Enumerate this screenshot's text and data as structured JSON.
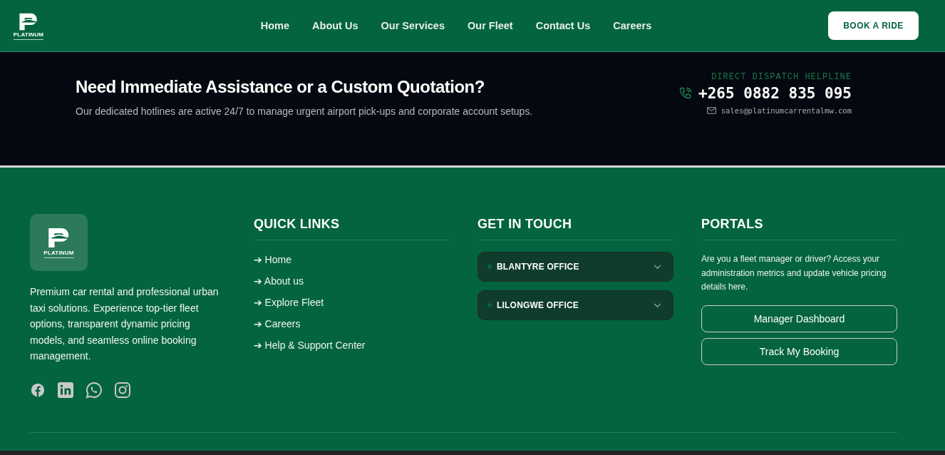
{
  "header": {
    "logo_text": "PLATINUM",
    "nav": [
      {
        "label": "Home",
        "selected": false
      },
      {
        "label": "About Us",
        "selected": false
      },
      {
        "label": "Our Services",
        "selected": false
      },
      {
        "label": "Our Fleet",
        "selected": false
      },
      {
        "label": "Contact Us",
        "selected": false
      },
      {
        "label": "Careers",
        "selected": false
      }
    ],
    "cta": "BOOK A RIDE"
  },
  "assistance": {
    "title": "Need Immediate Assistance or a Custom Quotation?",
    "text": "Our dedicated hotlines are active 24/7 to manage urgent airport pick-ups and corporate account setups.",
    "helpline_label": "DIRECT DISPATCH HELPLINE",
    "phone": "+265 0882 835 095",
    "email": "sales@platinumcarrentalmw.com"
  },
  "footer": {
    "logo_text": "PLATINUM",
    "about": "Premium car rental and professional urban taxi solutions. Experience top-tier fleet options, transparent dynamic pricing models, and seamless online booking management.",
    "social": [
      {
        "kind": "facebook"
      },
      {
        "kind": "linkedin"
      },
      {
        "kind": "whatsapp"
      },
      {
        "kind": "instagram"
      }
    ],
    "quick_links": {
      "title": "QUICK LINKS",
      "items": [
        "➔ Home",
        "➔ About us",
        "➔ Explore Fleet",
        "➔ Careers",
        "➔ Help & Support Center"
      ]
    },
    "contact": {
      "title": "GET IN TOUCH",
      "offices": [
        {
          "name": "BLANTYRE OFFICE",
          "expanded": false
        },
        {
          "name": "LILONGWE OFFICE",
          "expanded": false
        }
      ]
    },
    "portals": {
      "title": "PORTALS",
      "text": "Are you a fleet manager or driver? Access your administration metrics and update vehicle pricing details here.",
      "buttons": [
        "Manager Dashboard",
        "Track My Booking"
      ]
    }
  }
}
